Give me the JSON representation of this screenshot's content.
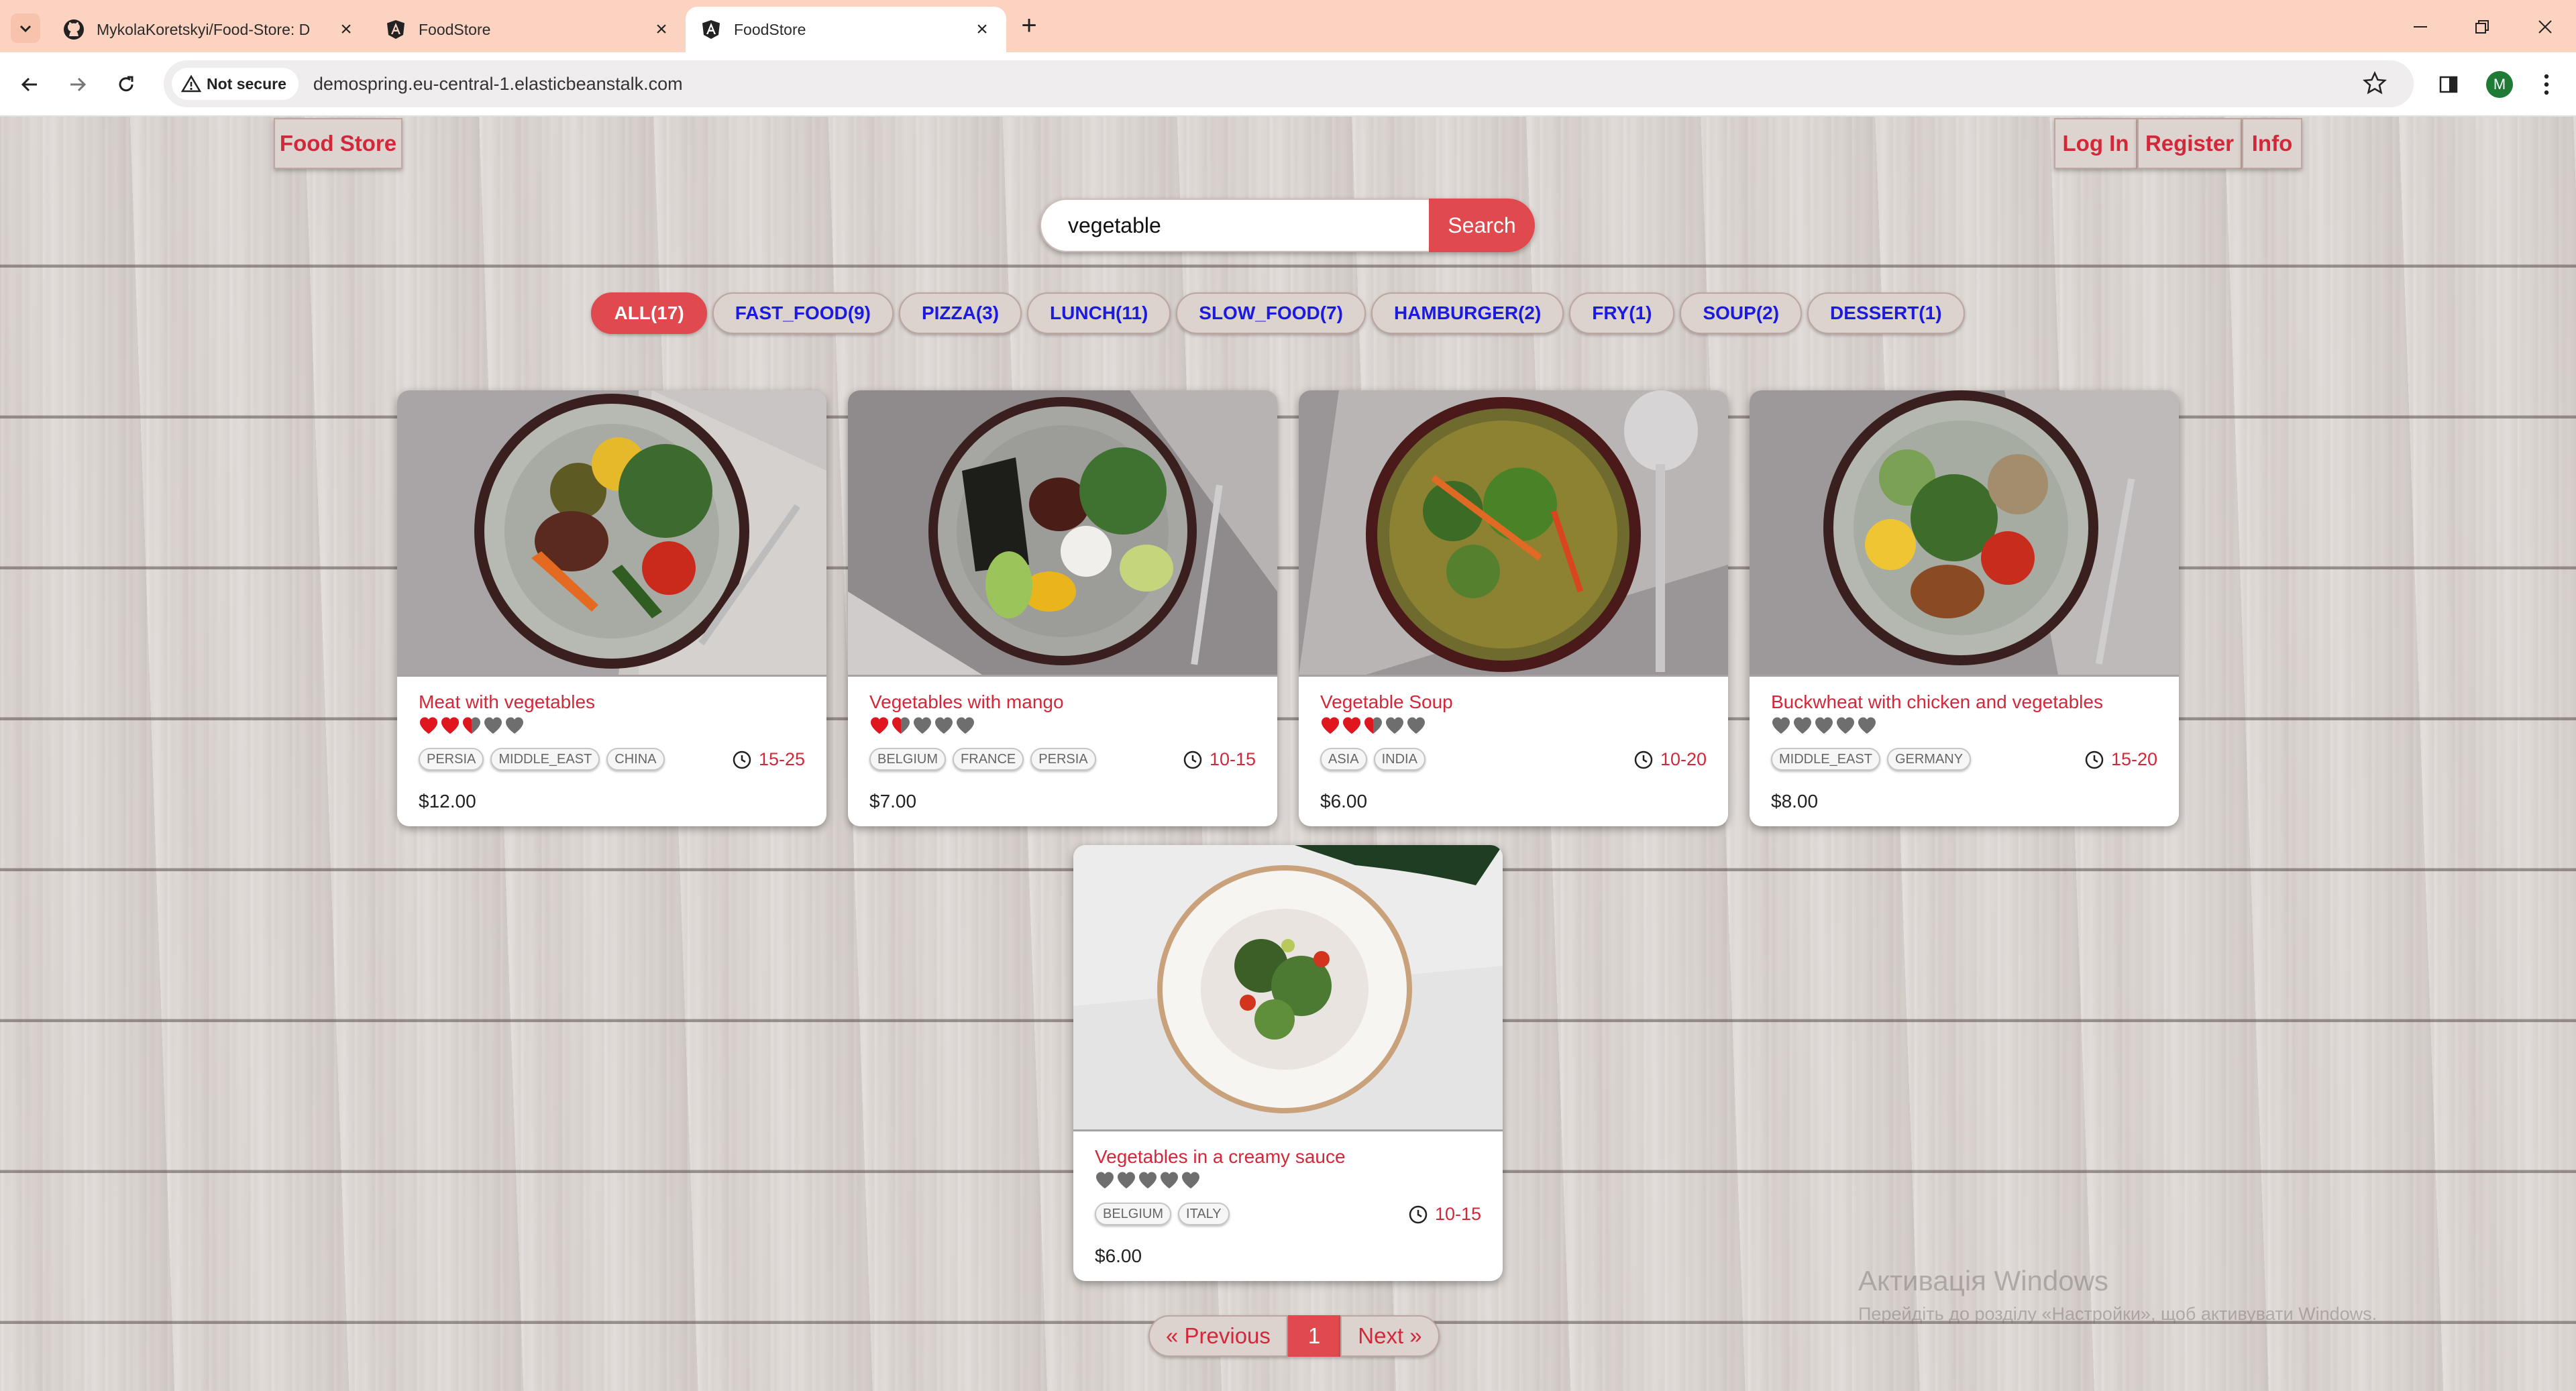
{
  "browser": {
    "tabs": [
      {
        "title": "MykolaKoretskyi/Food-Store: D",
        "icon": "github-icon"
      },
      {
        "title": "FoodStore",
        "icon": "angular-icon"
      },
      {
        "title": "FoodStore",
        "icon": "angular-icon"
      }
    ],
    "security_label": "Not secure",
    "url": "demospring.eu-central-1.elasticbeanstalk.com",
    "profile_initial": "M"
  },
  "header": {
    "brand": "Food Store",
    "login": "Log In",
    "register": "Register",
    "info": "Info"
  },
  "search": {
    "value": "vegetable",
    "button": "Search"
  },
  "tags": [
    "ALL(17)",
    "FAST_FOOD(9)",
    "PIZZA(3)",
    "LUNCH(11)",
    "SLOW_FOOD(7)",
    "HAMBURGER(2)",
    "FRY(1)",
    "SOUP(2)",
    "DESSERT(1)"
  ],
  "active_tag": "ALL(17)",
  "foods": [
    {
      "name": "Meat with vegetables",
      "rating": 2.5,
      "origins": [
        "PERSIA",
        "MIDDLE_EAST",
        "CHINA"
      ],
      "time": "15-25",
      "price": "$12.00"
    },
    {
      "name": "Vegetables with mango",
      "rating": 1.5,
      "origins": [
        "BELGIUM",
        "FRANCE",
        "PERSIA"
      ],
      "time": "10-15",
      "price": "$7.00"
    },
    {
      "name": "Vegetable Soup",
      "rating": 2.5,
      "origins": [
        "ASIA",
        "INDIA"
      ],
      "time": "10-20",
      "price": "$6.00"
    },
    {
      "name": "Buckwheat with chicken and vegetables",
      "rating": 0,
      "origins": [
        "MIDDLE_EAST",
        "GERMANY"
      ],
      "time": "15-20",
      "price": "$8.00"
    },
    {
      "name": "Vegetables in a creamy sauce",
      "rating": 0,
      "origins": [
        "BELGIUM",
        "ITALY"
      ],
      "time": "10-15",
      "price": "$6.00"
    }
  ],
  "pagination": {
    "previous": "« Previous",
    "current": "1",
    "next": "Next »"
  },
  "watermark": {
    "title": "Активація Windows",
    "subtitle": "Перейдіть до розділу «Настройки», щоб активувати Windows."
  },
  "colors": {
    "accent": "#e04a4e",
    "text_red": "#d3283a",
    "tag_blue": "#1a1ae0",
    "tab_bar": "#fcd3c0"
  }
}
